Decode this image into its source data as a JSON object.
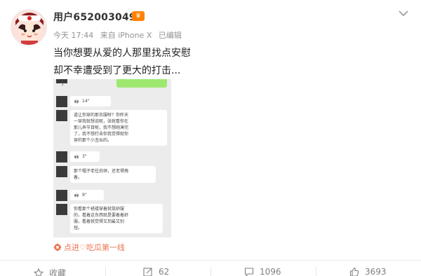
{
  "user": {
    "name": "用户6520030499",
    "badge_icon": "vip-icon"
  },
  "meta": {
    "time": "今天 17:44",
    "source": "来自 iPhone X",
    "edited": "已编辑"
  },
  "post": {
    "line1": "当你想要从爱的人那里找点安慰",
    "line2": "却不幸遭受到了更大的打击..."
  },
  "chat": {
    "top_char": "子",
    "voice1": "14\"",
    "text1": "道让你穿的那衣服呀？你昨天\n一穿我就想说呢，张就看你在\n那儿弄节目呢，我不想刚凑完\n了，我不想打击你我觉得就你\n穿的那个小丑似的。",
    "voice2": "3\"",
    "text2": "那个帽子老往后倾，还老得拽\n着。",
    "voice3": "9\"",
    "text3": "你看那个褡褛穿着就挺舒服\n的，看着这东西就是要着着舒\n服，看着就觉得又到最又别\n扭。"
  },
  "source_line": "点进♡吃瓜第一线",
  "footer": {
    "favorite": "收藏",
    "repost": "62",
    "comment": "1096",
    "like": "3693"
  }
}
